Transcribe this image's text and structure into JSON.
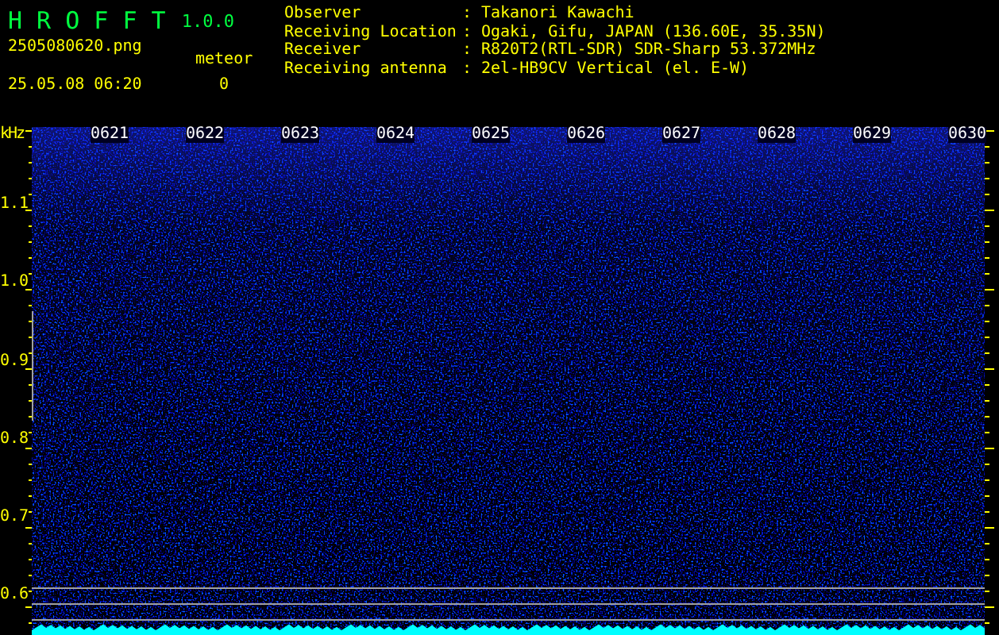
{
  "header": {
    "app_name": "H R O F F T",
    "version": "1.0.0",
    "filename": "2505080620.png",
    "datetime": "25.05.08 06:20",
    "counter_label": "meteor",
    "counter_value": "0"
  },
  "info": [
    {
      "label": "Observer",
      "separator": ":",
      "value": "Takanori Kawachi"
    },
    {
      "label": "Receiving Location",
      "separator": ":",
      "value": "Ogaki, Gifu, JAPAN (136.60E, 35.35N)"
    },
    {
      "label": "Receiver",
      "separator": ":",
      "value": "R820T2(RTL-SDR) SDR-Sharp 53.372MHz"
    },
    {
      "label": "Receiving antenna",
      "separator": ":",
      "value": "2el-HB9CV Vertical (el. E-W)"
    }
  ],
  "spectrogram": {
    "y_unit": "kHz",
    "y_labels": [
      "1.1",
      "1.0",
      "0.9",
      "0.8",
      "0.7",
      "0.6"
    ],
    "time_labels": [
      "0621",
      "0622",
      "0623",
      "0624",
      "0625",
      "0626",
      "0627",
      "0628",
      "0629",
      "0630"
    ]
  }
}
